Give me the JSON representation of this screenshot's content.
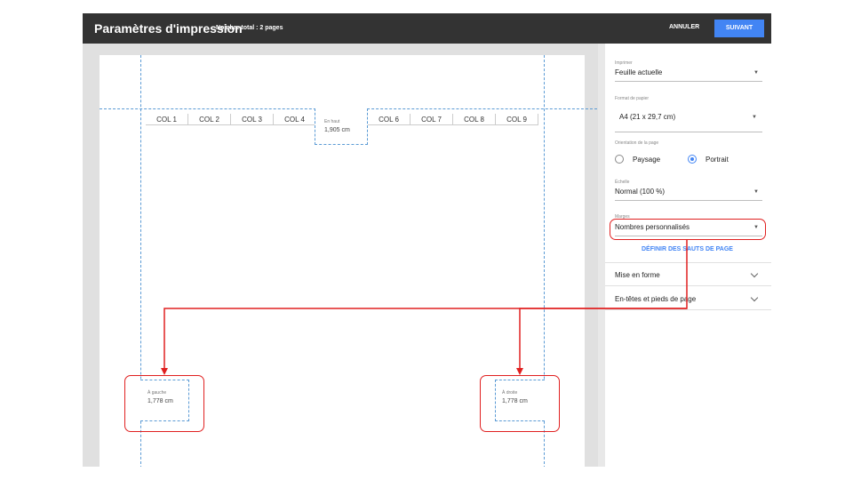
{
  "header": {
    "title": "Paramètres d'impression",
    "total_pages": "Nombre total : 2 pages",
    "cancel_label": "ANNULER",
    "next_label": "SUIVANT"
  },
  "preview": {
    "columns": [
      "COL 1",
      "COL 2",
      "COL 3",
      "COL 4",
      "COL 6",
      "COL 7",
      "COL 8",
      "COL 9"
    ],
    "top_margin": {
      "label": "En haut",
      "value": "1,905 cm"
    },
    "left_margin": {
      "label": "À gauche",
      "value": "1,778 cm"
    },
    "right_margin": {
      "label": "À droite",
      "value": "1,778 cm"
    }
  },
  "settings": {
    "print": {
      "label": "Imprimer",
      "value": "Feuille actuelle"
    },
    "paper": {
      "label": "Format de papier",
      "value": "A4 (21 x 29,7 cm)"
    },
    "orientation": {
      "label": "Orientation de la page",
      "landscape": "Paysage",
      "portrait": "Portrait",
      "selected": "portrait"
    },
    "scale": {
      "label": "Échelle",
      "value": "Normal (100 %)"
    },
    "margins": {
      "label": "Marges",
      "value": "Nombres personnalisés"
    },
    "page_breaks_label": "DÉFINIR DES SAUTS DE PAGE",
    "formatting_label": "Mise en forme",
    "headers_footers_label": "En-têtes et pieds de page"
  },
  "colors": {
    "accent": "#4285f4",
    "highlight": "#e02020",
    "guide": "#5b9bd5"
  }
}
